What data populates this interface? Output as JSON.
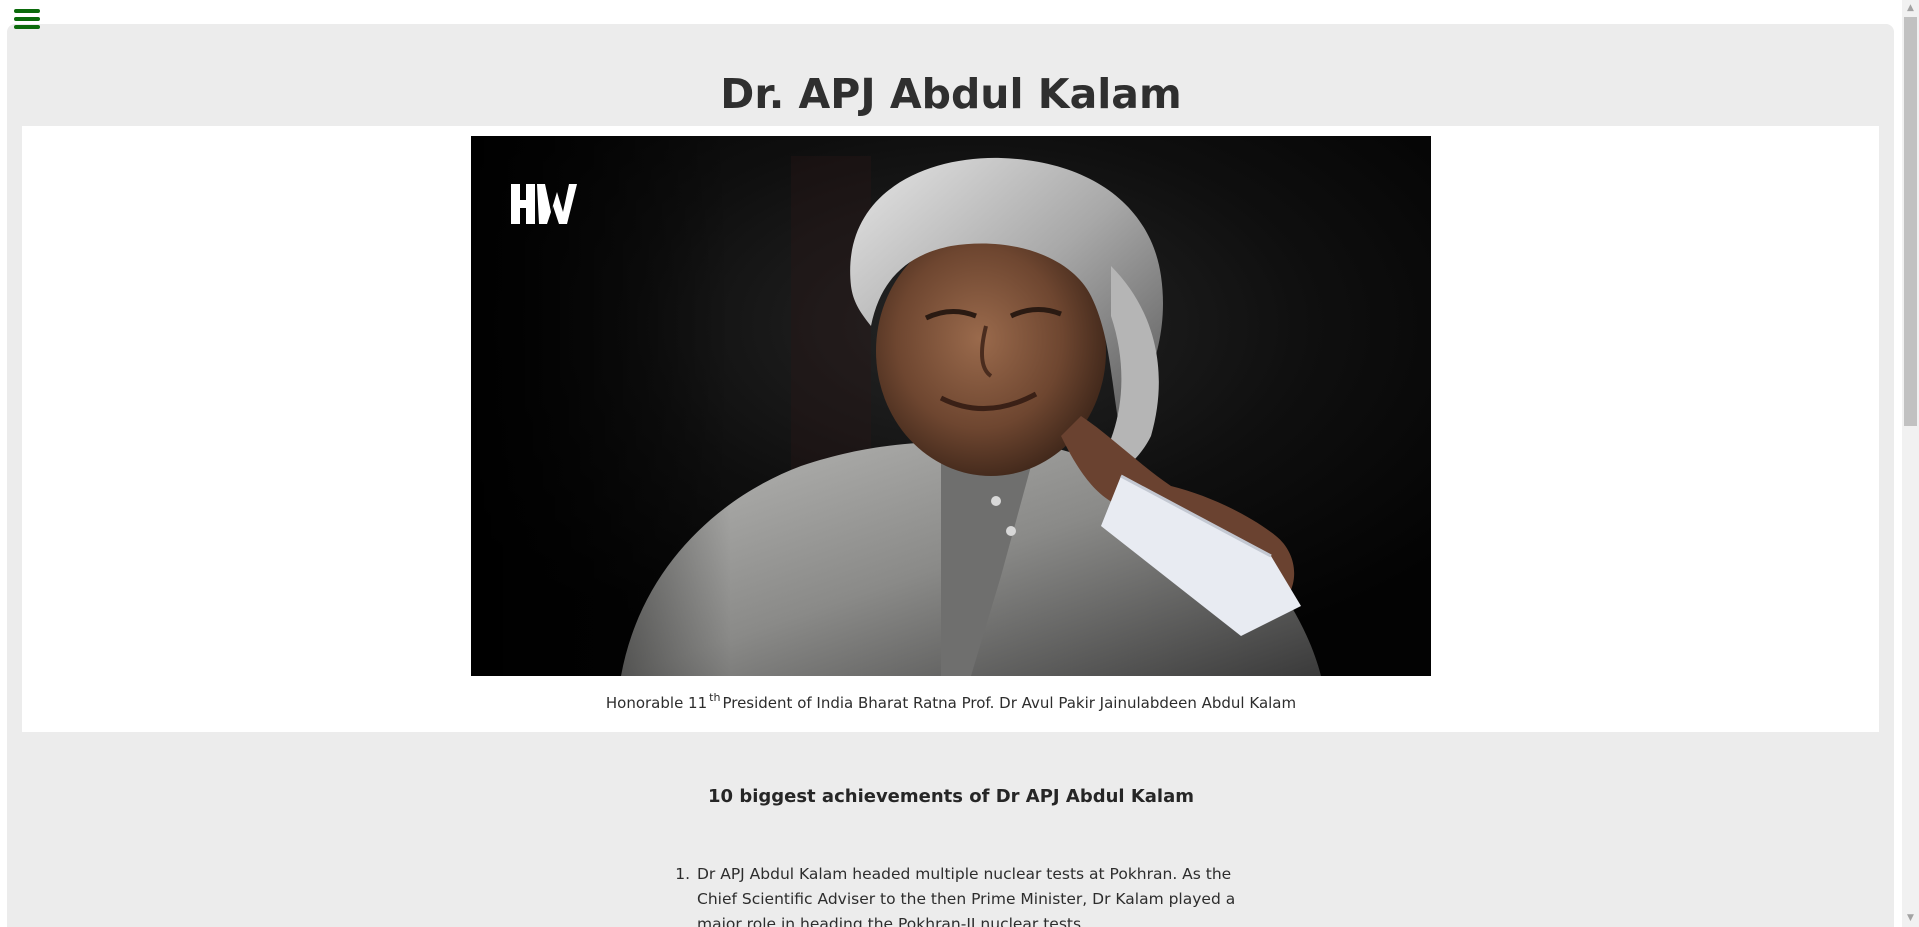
{
  "header": {
    "menu_icon": "hamburger-menu-icon"
  },
  "main": {
    "title": "Dr. APJ Abdul Kalam",
    "image": {
      "alt": "Portrait of Dr. APJ Abdul Kalam",
      "logo_text": "HW"
    },
    "caption": {
      "before": "Honorable 11",
      "sup": "th",
      "after": "President of India Bharat Ratna Prof. Dr Avul Pakir Jainulabdeen Abdul Kalam"
    },
    "section_heading": "10 biggest achievements of Dr APJ Abdul Kalam",
    "achievements": [
      "Dr APJ Abdul Kalam headed multiple nuclear tests at Pokhran. As the Chief Scientific Adviser to the then Prime Minister, Dr Kalam played a major role in heading the Pokhran-II nuclear tests."
    ]
  },
  "scrollbar": {
    "up_icon": "arrow-up-icon",
    "down_icon": "arrow-down-icon"
  },
  "colors": {
    "menu": "#0b6a0b",
    "panel": "#ececec",
    "card": "#ffffff",
    "text": "#2a2a2a"
  }
}
